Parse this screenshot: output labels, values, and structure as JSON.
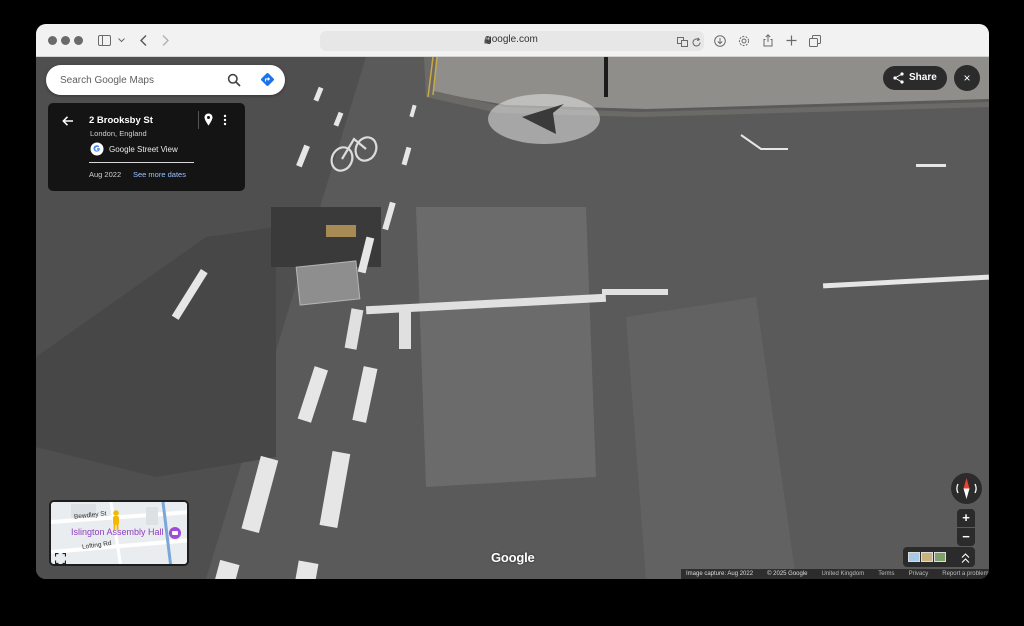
{
  "browser": {
    "url": "google.com",
    "icons": [
      "sidebar-icon",
      "chevron-down-icon",
      "back-icon",
      "forward-icon",
      "translate-icon",
      "reload-icon",
      "download-icon",
      "settings-icon",
      "share-icon",
      "new-tab-icon",
      "tabs-icon"
    ]
  },
  "maps": {
    "search": {
      "placeholder": "Search Google Maps"
    },
    "info_card": {
      "title": "2 Brooksby St",
      "subtitle": "London, England",
      "source": "Google Street View",
      "date": "Aug 2022",
      "more_dates": "See more dates"
    },
    "share_label": "Share",
    "close_label": "×",
    "minimap": {
      "place": "Islington Assembly Hall",
      "street1": "Bewdley St",
      "street2": "Lofting Rd"
    },
    "zoom_in": "+",
    "zoom_out": "−",
    "logo": "Google",
    "footer": {
      "capture": "Image capture: Aug 2022",
      "copyright": "© 2025 Google",
      "region": "United Kingdom",
      "terms": "Terms",
      "privacy": "Privacy",
      "report": "Report a problem"
    }
  },
  "colors": {
    "road": "#5b5b5b",
    "card_bg": "#141414",
    "button_bg": "#2b2b2b",
    "directions_blue": "#1a73e8",
    "link_blue": "#9cc0ff",
    "place_purple": "#8b3fbf"
  }
}
